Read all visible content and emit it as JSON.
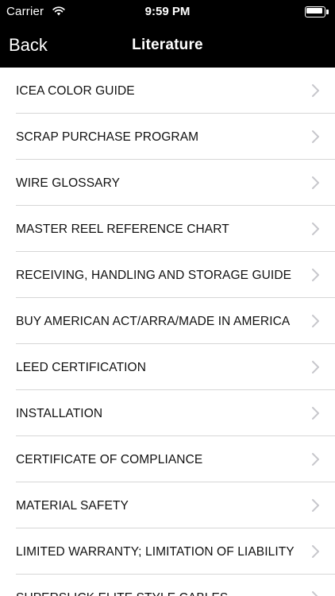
{
  "status_bar": {
    "carrier": "Carrier",
    "time": "9:59 PM"
  },
  "nav": {
    "back_label": "Back",
    "title": "Literature"
  },
  "list": {
    "items": [
      {
        "label": "ICEA COLOR GUIDE"
      },
      {
        "label": "SCRAP PURCHASE PROGRAM"
      },
      {
        "label": "WIRE GLOSSARY"
      },
      {
        "label": "MASTER REEL REFERENCE CHART"
      },
      {
        "label": "RECEIVING, HANDLING AND STORAGE GUIDE"
      },
      {
        "label": "BUY AMERICAN ACT/ARRA/MADE IN AMERICA"
      },
      {
        "label": "LEED CERTIFICATION"
      },
      {
        "label": "INSTALLATION"
      },
      {
        "label": "CERTIFICATE OF COMPLIANCE"
      },
      {
        "label": "MATERIAL SAFETY"
      },
      {
        "label": "LIMITED WARRANTY; LIMITATION OF LIABILITY"
      },
      {
        "label": "SUPERSLICK ELITE STYLE CABLES"
      }
    ]
  },
  "colors": {
    "bar_background": "#000000",
    "bar_text": "#ffffff",
    "list_background": "#ffffff",
    "separator": "#d6d6d6",
    "chevron": "#c7c7cc"
  },
  "icons": [
    "wifi-icon",
    "battery-icon",
    "chevron-right-icon"
  ]
}
